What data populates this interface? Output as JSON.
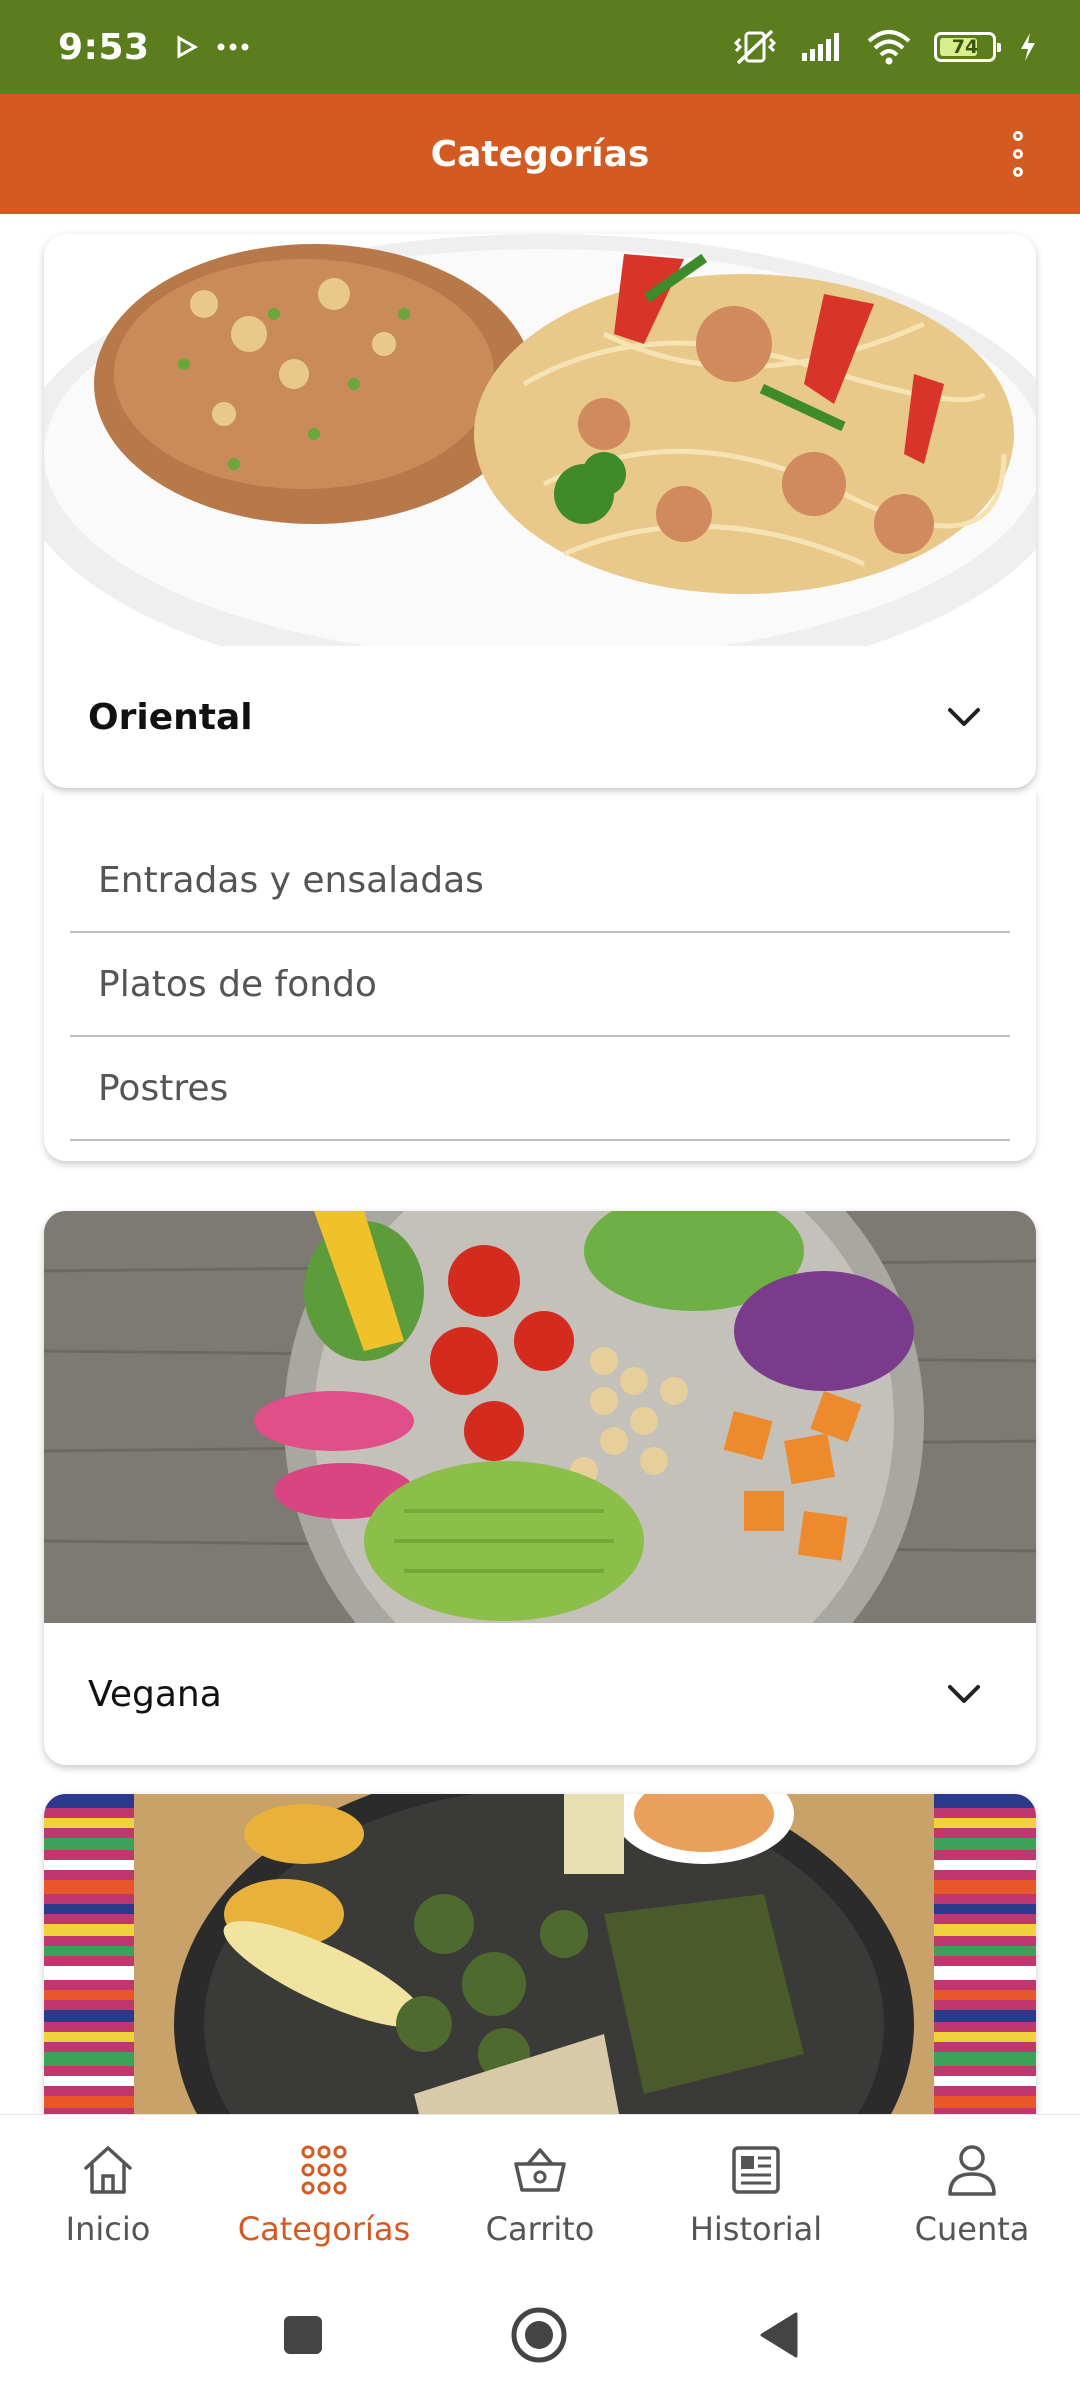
{
  "status_bar": {
    "time": "9:53",
    "battery": "74",
    "battery_level": 0.74,
    "left_icons": [
      "play-icon",
      "more-dots-icon"
    ],
    "right_icons": [
      "mute-vibrate-icon",
      "signal-icon",
      "wifi-icon",
      "battery-icon",
      "charging-icon"
    ]
  },
  "app_bar": {
    "title": "Categorías",
    "menu_icon": "overflow-menu-icon"
  },
  "categories": [
    {
      "name": "Oriental",
      "expanded": true,
      "subcategories": [
        "Entradas y ensaladas",
        "Platos de fondo",
        "Postres"
      ]
    },
    {
      "name": "Vegana",
      "expanded": false
    },
    {
      "name": "",
      "expanded": false
    }
  ],
  "bottom_nav": {
    "items": [
      {
        "label": "Inicio",
        "icon": "home-icon"
      },
      {
        "label": "Categorías",
        "icon": "grid-dots-icon",
        "active": true
      },
      {
        "label": "Carrito",
        "icon": "basket-icon"
      },
      {
        "label": "Historial",
        "icon": "newspaper-icon"
      },
      {
        "label": "Cuenta",
        "icon": "person-icon"
      }
    ]
  },
  "colors": {
    "status_bar": "#5b7d1e",
    "app_bar": "#d35a21",
    "accent": "#d35a21"
  }
}
